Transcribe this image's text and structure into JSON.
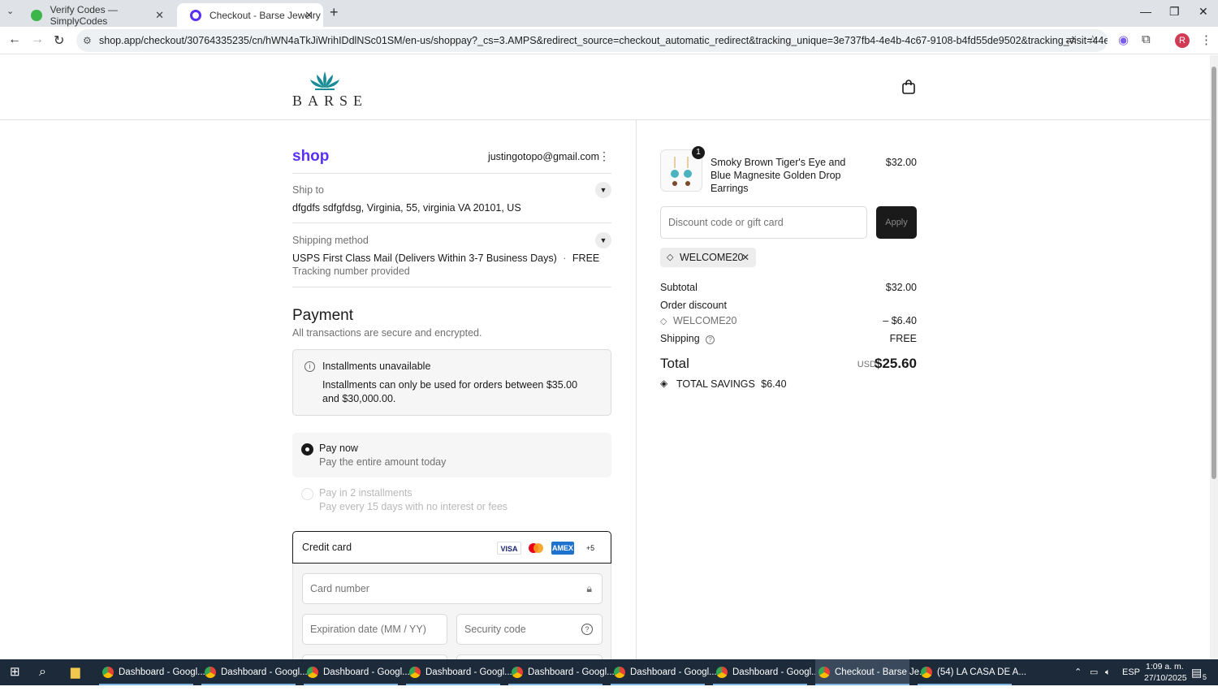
{
  "browser": {
    "tabs": [
      {
        "title": "Verify Codes — SimplyCodes",
        "active": false
      },
      {
        "title": "Checkout - Barse Jewelry",
        "active": true
      }
    ],
    "url": "shop.app/checkout/30764335235/cn/hWN4aTkJiWrihIDdlNSc01SM/en-us/shoppay?_cs=3.AMPS&redirect_source=checkout_automatic_redirect&tracking_unique=3e737fb4-4e4b-4c67-9108-b4fd55de9502&tracking_visit=44e509d8-cfb4-442e-...",
    "avatar_letter": "R"
  },
  "store": {
    "logo_text": "BARSE"
  },
  "account": {
    "brand": "shop",
    "email": "justingotopo@gmail.com"
  },
  "ship_to": {
    "label": "Ship to",
    "value": "dfgdfs sdfgfdsg, Virginia, 55, virginia VA 20101, US"
  },
  "shipping_method": {
    "label": "Shipping method",
    "value": "USPS First Class Mail (Delivers Within 3-7 Business Days)",
    "separator": "·",
    "price": "FREE",
    "note": "Tracking number provided"
  },
  "payment": {
    "heading": "Payment",
    "subheading": "All transactions are secure and encrypted.",
    "installments_title": "Installments unavailable",
    "installments_text": "Installments can only be used for orders between $35.00 and $30,000.00.",
    "options": [
      {
        "title": "Pay now",
        "subtitle": "Pay the entire amount today",
        "selected": true
      },
      {
        "title": "Pay in 2 installments",
        "subtitle": "Pay every 15 days with no interest or fees",
        "selected": false
      }
    ],
    "credit_card_label": "Credit card",
    "card_brands": [
      "VISA",
      "MC",
      "AMEX",
      "+5"
    ],
    "card_number_placeholder": "Card number",
    "expiry_placeholder": "Expiration date (MM / YY)",
    "security_placeholder": "Security code"
  },
  "summary": {
    "item": {
      "quantity": "1",
      "name": "Smoky Brown Tiger's Eye and Blue Magnesite Golden Drop Earrings",
      "price": "$32.00"
    },
    "discount_placeholder": "Discount code or gift card",
    "apply_label": "Apply",
    "applied_code": "WELCOME20",
    "subtotal_label": "Subtotal",
    "subtotal": "$32.00",
    "order_discount_label": "Order discount",
    "discount_code": "WELCOME20",
    "discount_amount": "– $6.40",
    "shipping_label": "Shipping",
    "shipping_value": "FREE",
    "total_label": "Total",
    "currency": "USD",
    "total": "$25.60",
    "savings_label": "TOTAL SAVINGS",
    "savings_amount": "$6.40"
  },
  "taskbar": {
    "apps": [
      "Dashboard - Googl...",
      "Dashboard - Googl...",
      "Dashboard - Googl...",
      "Dashboard - Googl...",
      "Dashboard - Googl...",
      "Dashboard - Googl...",
      "Dashboard - Googl...",
      "Checkout - Barse Je...",
      "(54) LA CASA DE A..."
    ],
    "language": "ESP",
    "time": "1:09 a. m.",
    "date": "27/10/2025",
    "notifications": "5"
  }
}
